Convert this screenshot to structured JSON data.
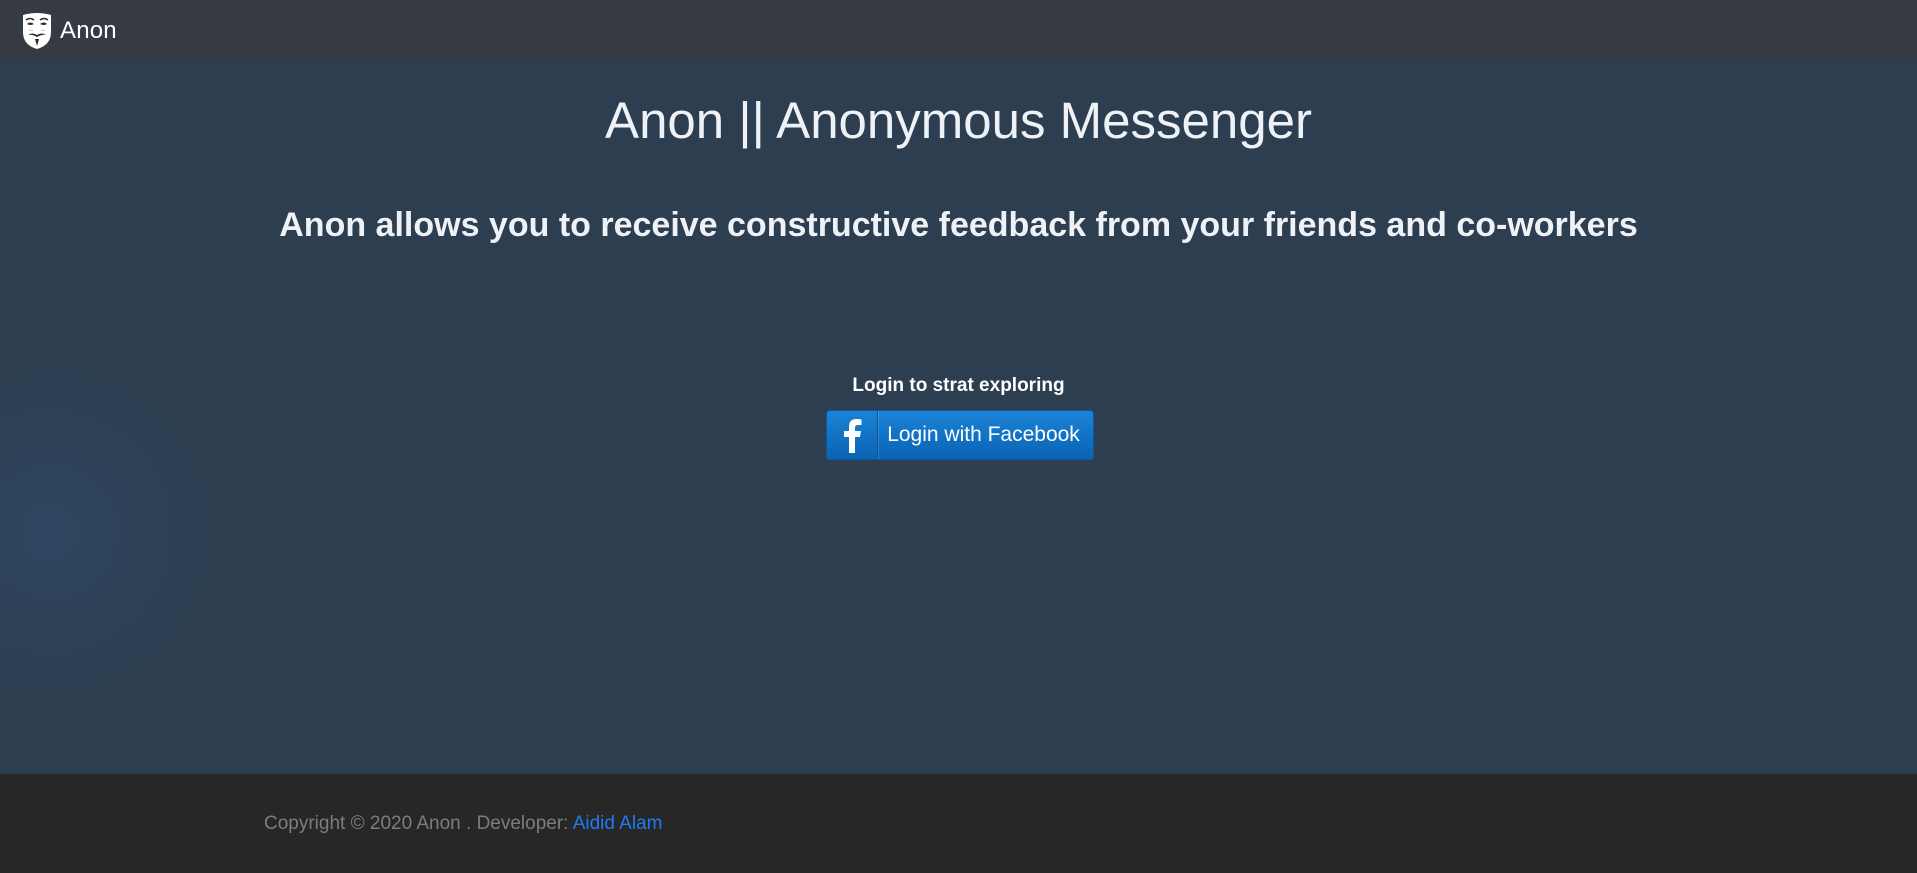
{
  "navbar": {
    "brand_name": "Anon",
    "logo_icon": "guy-fawkes-mask-icon"
  },
  "hero": {
    "title": "Anon || Anonymous Messenger",
    "subtitle": "Anon allows you to receive constructive feedback from your friends and co-workers"
  },
  "login": {
    "prompt": "Login to strat exploring",
    "button_label": "Login with Facebook",
    "button_icon": "facebook-icon",
    "button_color": "#1275c8"
  },
  "footer": {
    "copyright": "Copyright © 2020 Anon . Developer: ",
    "developer_link": "Aidid Alam",
    "link_color": "#1f7bf2"
  }
}
